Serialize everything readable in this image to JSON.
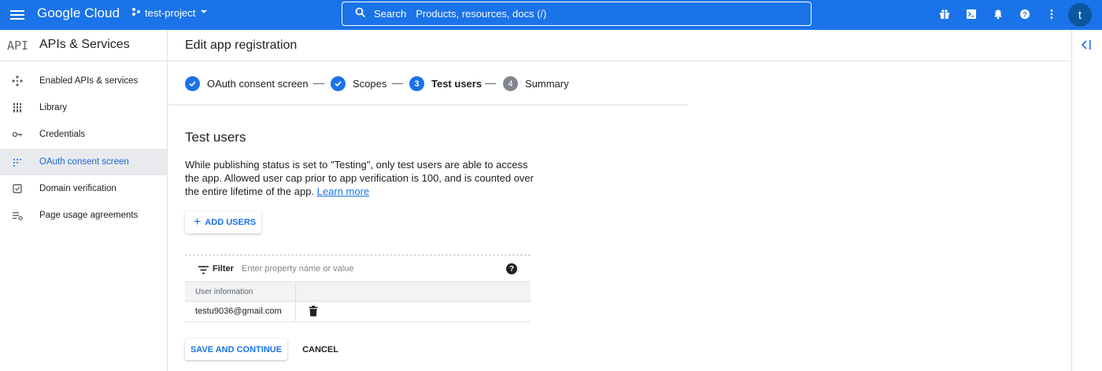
{
  "topbar": {
    "logo": "Google Cloud",
    "project": "test-project",
    "search_label": "Search",
    "search_placeholder": "Products, resources, docs (/)",
    "avatar_letter": "t"
  },
  "sidebar": {
    "api_badge": "API",
    "title": "APIs & Services",
    "items": [
      {
        "label": "Enabled APIs & services",
        "icon": "diamond-grid-icon"
      },
      {
        "label": "Library",
        "icon": "library-icon"
      },
      {
        "label": "Credentials",
        "icon": "key-icon"
      },
      {
        "label": "OAuth consent screen",
        "icon": "dots-grid-icon",
        "active": true
      },
      {
        "label": "Domain verification",
        "icon": "checkbox-icon"
      },
      {
        "label": "Page usage agreements",
        "icon": "settings-list-icon"
      }
    ]
  },
  "header": {
    "title": "Edit app registration"
  },
  "stepper": {
    "steps": [
      {
        "label": "OAuth consent screen",
        "state": "done"
      },
      {
        "label": "Scopes",
        "state": "done"
      },
      {
        "label": "Test users",
        "state": "current",
        "number": "3"
      },
      {
        "label": "Summary",
        "state": "todo",
        "number": "4"
      }
    ]
  },
  "content": {
    "title": "Test users",
    "description": "While publishing status is set to \"Testing\", only test users are able to access the app. Allowed user cap prior to app verification is 100, and is counted over the entire lifetime of the app.",
    "learn_more": "Learn more",
    "add_users": "ADD USERS"
  },
  "table": {
    "filter_label": "Filter",
    "filter_placeholder": "Enter property name or value",
    "column_header": "User information",
    "rows": [
      {
        "email": "testu9036@gmail.com"
      }
    ]
  },
  "actions": {
    "save": "SAVE AND CONTINUE",
    "cancel": "CANCEL"
  },
  "colors": {
    "accent": "#1a73e8",
    "topbar": "#1a73e8"
  }
}
